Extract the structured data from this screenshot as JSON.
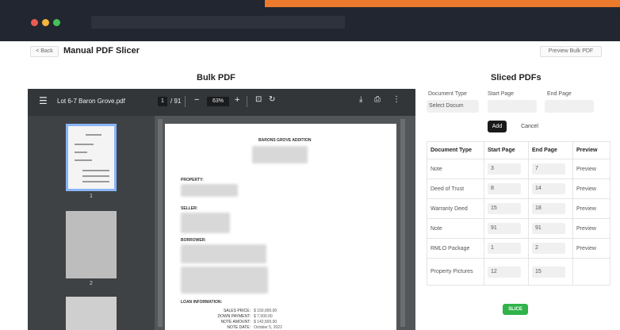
{
  "header": {
    "back_label": "< Back",
    "title": "Manual PDF Slicer",
    "preview_label": "Preview Bulk PDF"
  },
  "bulk": {
    "title": "Bulk PDF"
  },
  "viewer": {
    "filename": "Lot 6-7 Baron Grove.pdf",
    "current_page": "1",
    "page_count": "/ 91",
    "zoom": "63%",
    "thumb_numbers": [
      "1",
      "2"
    ]
  },
  "pdf": {
    "heading": "BARONS GROVE ADDITION",
    "property": "PROPERTY:",
    "seller": "SELLER:",
    "borrower": "BORROWER:",
    "loan_info": "LOAN INFORMATION:",
    "loan_rows": [
      {
        "label": "SALES PRICE:",
        "value": "$ 150,000.00"
      },
      {
        "label": "DOWN PAYMENT:",
        "value": "$ 7,500.00"
      },
      {
        "label": "NOTE AMOUNT:",
        "value": "$ 142,500.00"
      },
      {
        "label": "NOTE DATE:",
        "value": "October 5, 2022"
      }
    ]
  },
  "sliced": {
    "title": "Sliced PDFs",
    "form": {
      "doc_type_label": "Document Type",
      "doc_type_value": "Select Docum",
      "start_label": "Start Page",
      "end_label": "End Page",
      "add_label": "Add",
      "cancel_label": "Cancel"
    },
    "columns": [
      "Document Type",
      "Start Page",
      "End Page",
      "Preview"
    ],
    "rows": [
      {
        "type": "Note",
        "start": "3",
        "end": "7",
        "preview": "Preview"
      },
      {
        "type": "Deed of Trust",
        "start": "8",
        "end": "14",
        "preview": "Preview"
      },
      {
        "type": "Warranty Deed",
        "start": "15",
        "end": "18",
        "preview": "Preview"
      },
      {
        "type": "Note",
        "start": "91",
        "end": "91",
        "preview": "Preview"
      },
      {
        "type": "RMLO Package",
        "start": "1",
        "end": "2",
        "preview": "Preview"
      },
      {
        "type": "Property Pictures",
        "start": "12",
        "end": "15",
        "preview": ""
      }
    ],
    "slice_label": "SLICE"
  }
}
